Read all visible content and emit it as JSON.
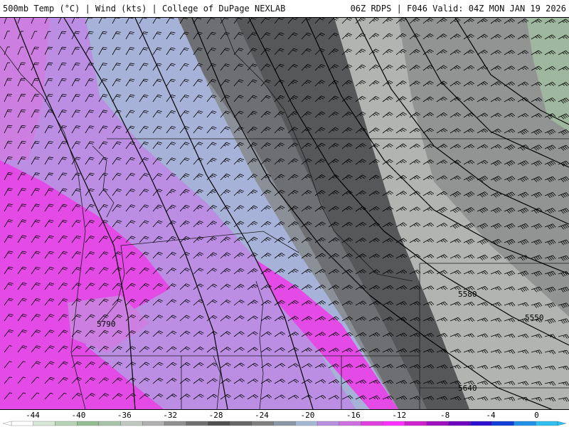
{
  "header": {
    "title_left": "500mb Temp (°C) | Wind (kts) | College of DuPage NEXLAB",
    "title_right": "06Z RDPS | F046 Valid: 04Z MON JAN 19 2026"
  },
  "map": {
    "contour_labels": [
      "5580",
      "5550",
      "5790",
      "5640"
    ],
    "temperature_colors": {
      "band_-38_-34": "#e44ae6",
      "band_-34_-30": "#cc7fe0",
      "band_-30_-28": "#bb8ee4",
      "band_-28_-26": "#a7b2d8",
      "band_-26_-24": "#8a8f98",
      "band_-24_-22": "#6d6f72",
      "band_-22_-20": "#565759",
      "band_-20_-18": "#929494",
      "band_-18_-16": "#b2b4b2",
      "band_-16_-14": "#9fb79e"
    }
  },
  "colorbar": {
    "ticks": [
      "-44",
      "-40",
      "-36",
      "-32",
      "-28",
      "-24",
      "-20",
      "-16",
      "-12",
      "-8",
      "-4",
      "0"
    ],
    "colors": [
      "#ffffff",
      "#d8e8d8",
      "#b6d3b6",
      "#94bd94",
      "#a8c4a8",
      "#c0c8c0",
      "#b0b0b0",
      "#909090",
      "#707070",
      "#505050",
      "#686868",
      "#808080",
      "#8c96a4",
      "#a4b8d4",
      "#b890e0",
      "#d070e0",
      "#e040e0",
      "#ff30ff",
      "#d020d0",
      "#a010c0",
      "#7000c0",
      "#3010d0",
      "#1040d8",
      "#2090e8",
      "#30c0f0"
    ]
  }
}
